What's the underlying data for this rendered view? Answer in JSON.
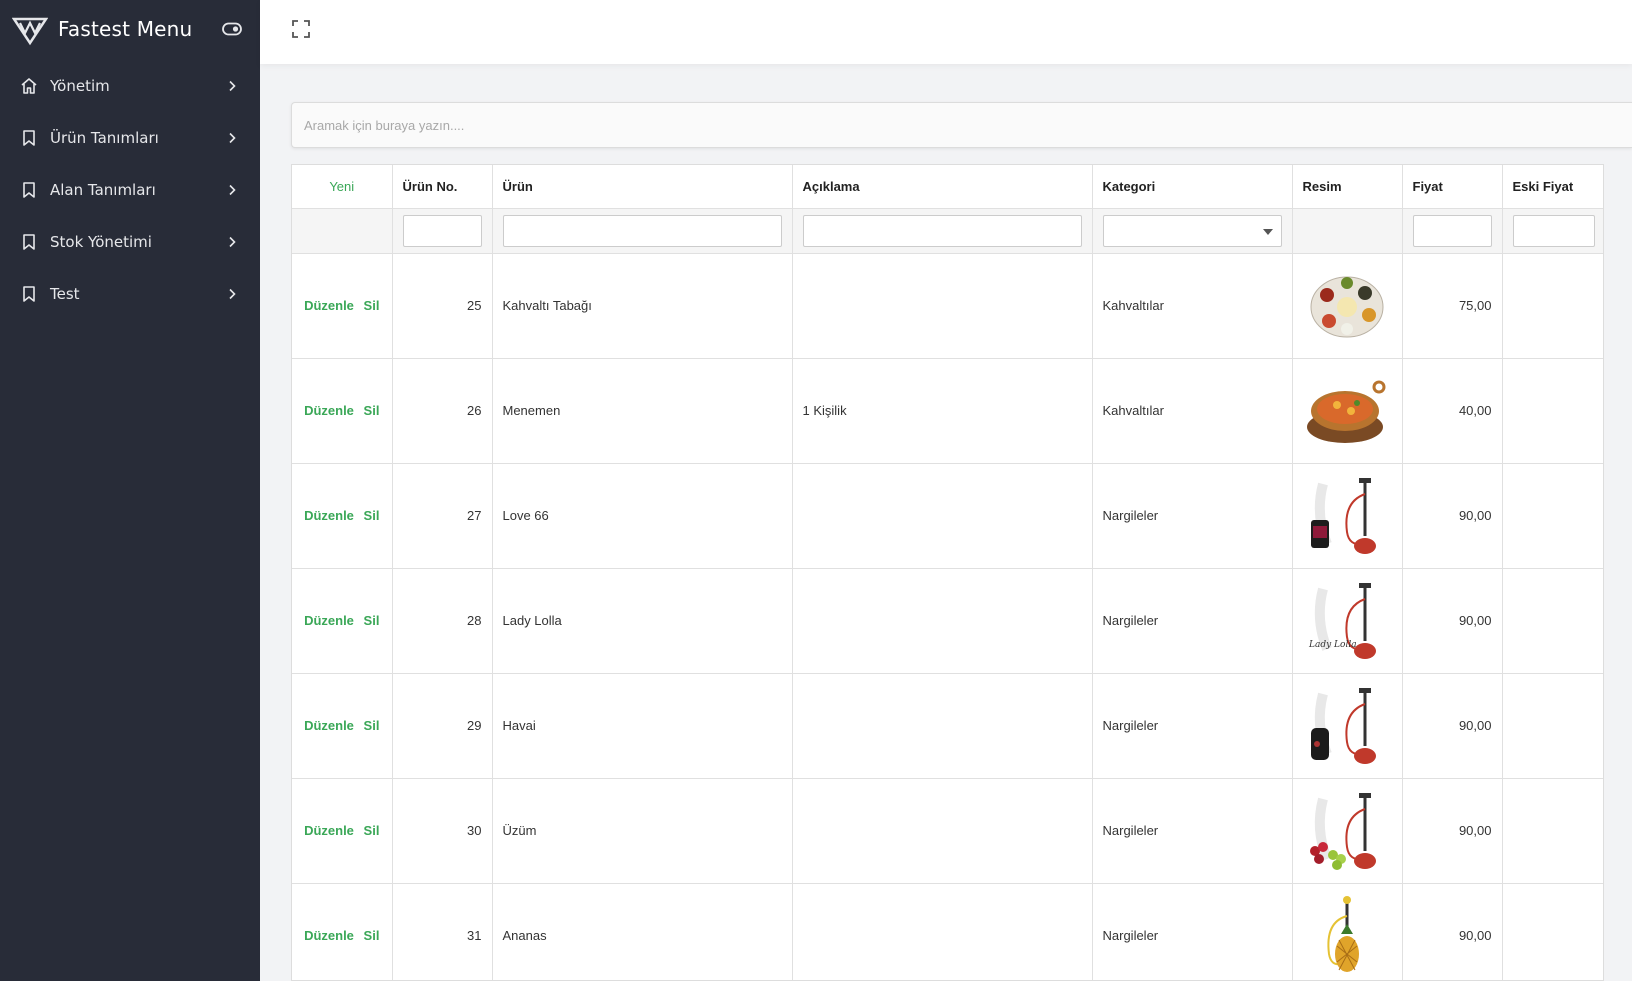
{
  "app": {
    "title": "Fastest Menu"
  },
  "sidebar": {
    "items": [
      {
        "label": "Yönetim",
        "icon": "home-icon"
      },
      {
        "label": "Ürün Tanımları",
        "icon": "bookmark-icon"
      },
      {
        "label": "Alan Tanımları",
        "icon": "bookmark-icon"
      },
      {
        "label": "Stok Yönetimi",
        "icon": "bookmark-icon"
      },
      {
        "label": "Test",
        "icon": "bookmark-icon"
      }
    ]
  },
  "topbar": {
    "fullscreen_icon": "fullscreen-icon"
  },
  "search": {
    "placeholder": "Aramak için buraya yazın...."
  },
  "table": {
    "new_label": "Yeni",
    "columns": [
      "Ürün No.",
      "Ürün",
      "Açıklama",
      "Kategori",
      "Resim",
      "Fiyat",
      "Eski Fiyat"
    ],
    "edit_label": "Düzenle",
    "delete_label": "Sil",
    "rows": [
      {
        "no": "25",
        "urun": "Kahvaltı Tabağı",
        "aciklama": "",
        "kategori": "Kahvaltılar",
        "resim": "breakfast-plate-image",
        "fiyat": "75,00",
        "eski_fiyat": ""
      },
      {
        "no": "26",
        "urun": "Menemen",
        "aciklama": "1 Kişilik",
        "kategori": "Kahvaltılar",
        "resim": "menemen-pan-image",
        "fiyat": "40,00",
        "eski_fiyat": ""
      },
      {
        "no": "27",
        "urun": "Love 66",
        "aciklama": "",
        "kategori": "Nargileler",
        "resim": "hookah-love66-image",
        "fiyat": "90,00",
        "eski_fiyat": ""
      },
      {
        "no": "28",
        "urun": "Lady Lolla",
        "aciklama": "",
        "kategori": "Nargileler",
        "resim": "hookah-ladylolla-image",
        "image_text": "Lady Lolla",
        "fiyat": "90,00",
        "eski_fiyat": ""
      },
      {
        "no": "29",
        "urun": "Havai",
        "aciklama": "",
        "kategori": "Nargileler",
        "resim": "hookah-havai-image",
        "fiyat": "90,00",
        "eski_fiyat": ""
      },
      {
        "no": "30",
        "urun": "Üzüm",
        "aciklama": "",
        "kategori": "Nargileler",
        "resim": "hookah-grape-image",
        "fiyat": "90,00",
        "eski_fiyat": ""
      },
      {
        "no": "31",
        "urun": "Ananas",
        "aciklama": "",
        "kategori": "Nargileler",
        "resim": "hookah-pineapple-image",
        "fiyat": "90,00",
        "eski_fiyat": ""
      }
    ]
  },
  "colors": {
    "sidebar_bg": "#282c38",
    "accent_green": "#3aa757",
    "topbar_bg": "#ffffff"
  }
}
